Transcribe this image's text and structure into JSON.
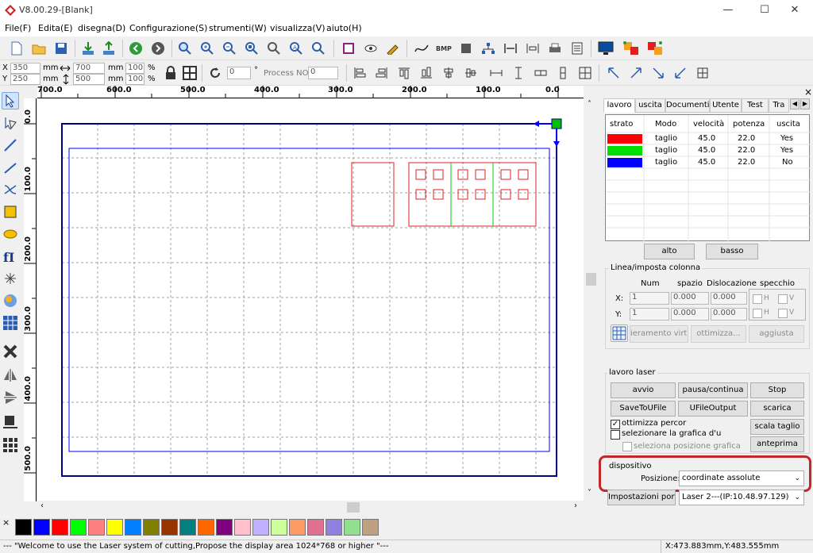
{
  "window": {
    "title": "V8.00.29-[Blank]",
    "minimize": "—",
    "maximize": "☐",
    "close": "✕"
  },
  "menu": [
    "File(F)",
    "Edita(E)",
    "disegna(D)",
    "Configurazione(S)",
    "strumenti(W)",
    "visualizza(V)",
    "aiuto(H)"
  ],
  "props": {
    "x_label": "X",
    "x_value": "350",
    "x_unit": "mm",
    "y_label": "Y",
    "y_value": "250",
    "y_unit": "mm",
    "w_value": "700",
    "w_unit": "mm",
    "h_value": "500",
    "h_unit": "mm",
    "sx_value": "100",
    "sx_unit": "%",
    "sy_value": "100",
    "sy_unit": "%",
    "rotate_value": "0",
    "rotate_unit": "°",
    "process_label": "Process NO:",
    "process_value": "0"
  },
  "ruler": {
    "top": [
      "700.0",
      "600.0",
      "500.0",
      "400.0",
      "300.0",
      "200.0",
      "100.0",
      "0.0"
    ],
    "left": [
      "0.0",
      "100.0",
      "200.0",
      "300.0",
      "400.0",
      "500.0"
    ]
  },
  "panel": {
    "close_glyph": "×",
    "tabs": [
      "lavoro",
      "uscita",
      "Documenti",
      "Utente",
      "Test",
      "Tra"
    ],
    "table": {
      "headers": [
        "strato",
        "Modo",
        "velocità",
        "potenza",
        "uscita"
      ],
      "rows": [
        {
          "color": "#ff0000",
          "mode": "taglio",
          "speed": "45.0",
          "power": "22.0",
          "output": "Yes"
        },
        {
          "color": "#00e000",
          "mode": "taglio",
          "speed": "45.0",
          "power": "22.0",
          "output": "Yes"
        },
        {
          "color": "#0000ff",
          "mode": "taglio",
          "speed": "45.0",
          "power": "22.0",
          "output": "No"
        }
      ]
    },
    "up_button": "alto",
    "down_button": "basso",
    "array": {
      "group_label": "Linea/imposta colonna",
      "col_num": "Num",
      "col_space": "spazio",
      "col_disloc": "Dislocazione",
      "col_mirror": "specchio",
      "x_label": "X:",
      "x_num": "1",
      "x_space": "0.000",
      "x_disloc": "0.000",
      "y_label": "Y:",
      "y_num": "1",
      "y_space": "0.000",
      "y_disloc": "0.000",
      "mirror_h": "H",
      "mirror_v": "V",
      "virtual_button": "ieramento virtu",
      "optimize_button": "ottimizza...",
      "adjust_button": "aggiusta"
    },
    "laser": {
      "group_label": "lavoro laser",
      "start": "avvio",
      "pause": "pausa/continua",
      "stop": "Stop",
      "save_file": "SaveToUFile",
      "ufile_output": "UFileOutput",
      "download": "scarica",
      "opt_path_label": "ottimizza percor",
      "opt_path_checked": true,
      "select_graphic_label": "selezionare la grafica d'u",
      "select_graphic_checked": false,
      "select_pos_label": "seleziona posizione grafica",
      "scale_button": "scala taglio",
      "preview_button": "anteprima"
    },
    "device": {
      "group_label": "dispositivo",
      "position_label": "Posizione:",
      "position_value": "coordinate assolute",
      "port_button": "Impostazioni porta",
      "port_value": "Laser 2---(IP:10.48.97.129)"
    }
  },
  "palette": {
    "x_glyph": "×",
    "colors": [
      "#000000",
      "#0000ff",
      "#ff0000",
      "#00ff00",
      "#ff8080",
      "#ffff00",
      "#0080ff",
      "#808000",
      "#993300",
      "#008080",
      "#ff6600",
      "#800080",
      "#ffc0cb",
      "#c0b0ff",
      "#ccff99",
      "#ff9966",
      "#e07090",
      "#9080e0",
      "#90e090",
      "#c0a080"
    ]
  },
  "status": {
    "message": "--- \"Welcome to use the Laser system of cutting,Propose the display area 1024*768 or higher \"---",
    "coords": "X:473.883mm,Y:483.555mm"
  }
}
